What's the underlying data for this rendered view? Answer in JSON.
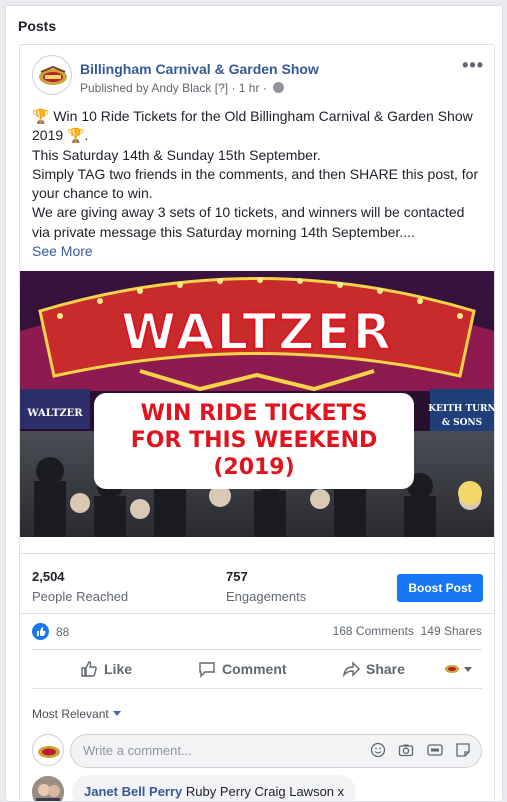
{
  "panel": {
    "title": "Posts"
  },
  "post": {
    "page_name": "Billingham Carnival & Garden Show",
    "published_by": "Published by Andy Black",
    "help_marker": "[?]",
    "time": "1 hr",
    "separator": "·",
    "more_icon": "more-dots-icon",
    "text_lines": [
      "Win 10 Ride Tickets for the Old Billingham Carnival & Garden Show",
      "2019",
      "This Saturday 14th & Sunday 15th September.",
      "Simply TAG two friends in the comments, and then SHARE this post, for",
      "your chance to win.",
      "We are giving away 3 sets of 10 tickets, and winners will be contacted",
      "via private message this Saturday morning 14th September...."
    ],
    "trophy_glyph": "🏆",
    "see_more": "See More",
    "image": {
      "ride_sign": "WALTZER",
      "side_left": "WALTZER",
      "side_right_1": "KEITH TURN",
      "side_right_2": "& SONS",
      "banner_line1": "WIN RIDE TICKETS",
      "banner_line2": "FOR THIS WEEKEND",
      "banner_line3": "(2019)"
    }
  },
  "stats": {
    "reached_value": "2,504",
    "reached_label": "People Reached",
    "engagements_value": "757",
    "engagements_label": "Engagements",
    "boost_label": "Boost Post"
  },
  "reactions": {
    "like_count": "88",
    "comments": "168 Comments",
    "shares": "149 Shares"
  },
  "actions": {
    "like": "Like",
    "comment": "Comment",
    "share": "Share"
  },
  "comments": {
    "sort_label": "Most Relevant",
    "composer_placeholder": "Write a comment...",
    "first": {
      "author": "Janet Bell Perry",
      "text": "Ruby Perry Craig Lawson x"
    }
  },
  "colors": {
    "link": "#365899",
    "primary_button": "#1877f2",
    "muted_text": "#606770",
    "banner_red": "#e0141e"
  }
}
